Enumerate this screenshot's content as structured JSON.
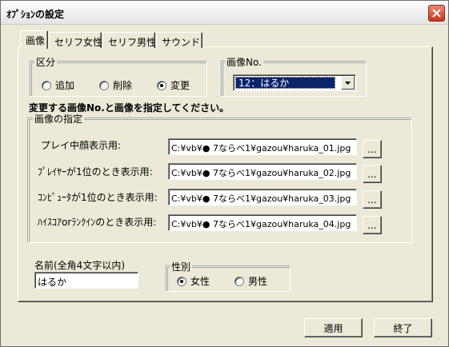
{
  "window": {
    "title": "ｵﾌﾟｼｮﾝの設定"
  },
  "tabs": [
    {
      "label": "画像"
    },
    {
      "label": "セリフ女性"
    },
    {
      "label": "セリフ男性"
    },
    {
      "label": "サウンド"
    }
  ],
  "section": {
    "label": "区分",
    "options": [
      "追加",
      "削除",
      "変更"
    ],
    "selected": "変更"
  },
  "image_no": {
    "label": "画像No.",
    "selected": "12：はるか"
  },
  "instruction": "変更する画像No.と画像を指定してください。",
  "image_spec": {
    "label": "画像の指定",
    "rows": [
      {
        "label": "プレイ中顔表示用:",
        "path": "C:¥vb¥● 7ならべ1¥gazou¥haruka_01.jpg"
      },
      {
        "label": "ﾌﾟﾚｲﾔｰが1位のとき表示用:",
        "path": "C:¥vb¥● 7ならべ1¥gazou¥haruka_02.jpg"
      },
      {
        "label": "ｺﾝﾋﾟｭｰﾀが1位のとき表示用:",
        "path": "C:¥vb¥● 7ならべ1¥gazou¥haruka_03.jpg"
      },
      {
        "label": "ﾊｲｽｺｱorﾗﾝｸｲﾝのとき表示用:",
        "path": "C:¥vb¥● 7ならべ1¥gazou¥haruka_04.jpg"
      }
    ],
    "browse_label": "..."
  },
  "name": {
    "label": "名前(全角4文字以内)",
    "value": "はるか"
  },
  "gender": {
    "label": "性別",
    "options": [
      "女性",
      "男性"
    ],
    "selected": "女性"
  },
  "buttons": {
    "apply": "適用",
    "close": "終了"
  }
}
